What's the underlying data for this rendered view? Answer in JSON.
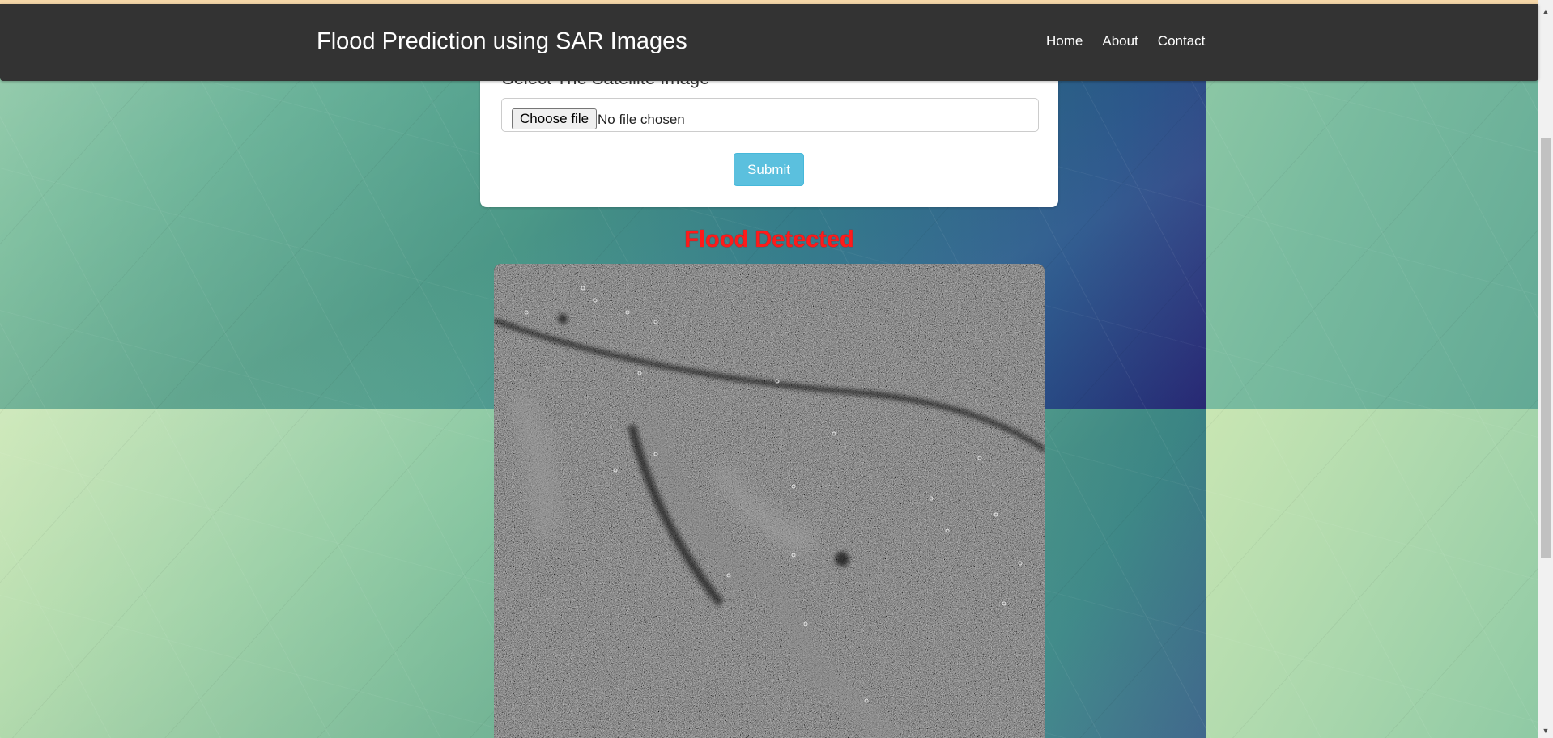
{
  "navbar": {
    "brand": "Flood Prediction using SAR Images",
    "links": [
      "Home",
      "About",
      "Contact"
    ]
  },
  "form": {
    "label": "Select The Satellite Image",
    "file_button": "Choose file",
    "file_status": "No file chosen",
    "submit_label": "Submit"
  },
  "result": {
    "title": "Flood Detected",
    "image_semantic": "sar-satellite-image"
  },
  "colors": {
    "navbar_bg": "#333333",
    "submit_bg": "#5bc0de",
    "result_title": "#ff1a1a",
    "top_strip": "#f5d7a8"
  }
}
